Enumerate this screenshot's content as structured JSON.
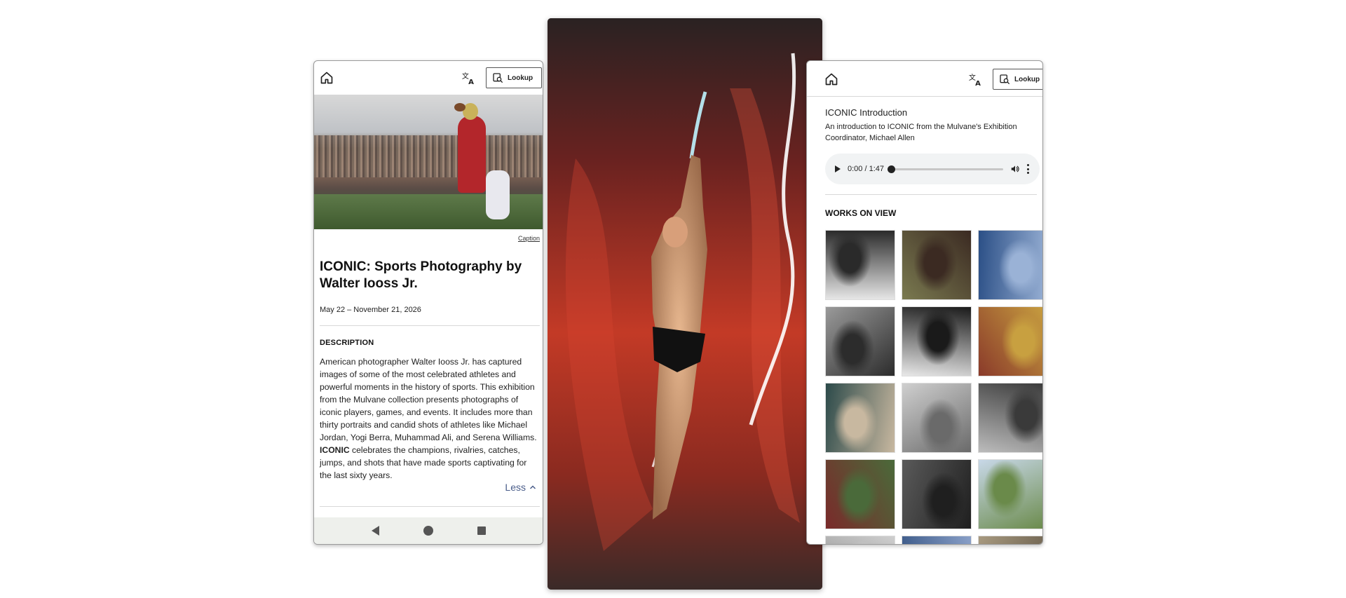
{
  "left_screen": {
    "lookup_label": "Lookup",
    "caption_link": "Caption",
    "title": "ICONIC: Sports Photography by Walter Iooss Jr.",
    "dates": "May 22 – November 21, 2026",
    "description_label": "DESCRIPTION",
    "description_part1": "American photographer Walter Iooss Jr. has captured images of some of the most celebrated athletes and powerful moments in the history of sports. This exhibition from the Mulvane collection presents photographs of iconic players, games, and events. It includes more than thirty portraits and candid shots of athletes like Michael Jordan, Yogi Berra, Muhammad Ali, and Serena Williams. ",
    "description_bold": "ICONIC",
    "description_part2": " celebrates the champions, rivalries, catches, jumps, and shots that have made sports captivating for the last sixty years.",
    "less_label": "Less"
  },
  "right_screen": {
    "lookup_label": "Lookup",
    "audio_title": "ICONIC Introduction",
    "audio_subtitle": "An introduction to ICONIC from the Mulvane's Exhibition Coordinator, Michael Allen",
    "audio_time": "0:00 / 1:47",
    "audio_progress": 0.0,
    "works_label": "WORKS ON VIEW",
    "thumbnails": [
      {
        "colors": [
          "#e6e6e6",
          "#2a2a2a"
        ]
      },
      {
        "colors": [
          "#7a7a50",
          "#3b2a22"
        ]
      },
      {
        "colors": [
          "#2b4f86",
          "#9ab2d6"
        ]
      },
      {
        "colors": [
          "#9a9a9a",
          "#2c2c2c"
        ]
      },
      {
        "colors": [
          "#e8e8e8",
          "#1a1a1a"
        ]
      },
      {
        "colors": [
          "#8a3a2a",
          "#c8a040"
        ]
      },
      {
        "colors": [
          "#2c4a4a",
          "#c8b8a0"
        ]
      },
      {
        "colors": [
          "#cfcfcf",
          "#6a6a6a"
        ]
      },
      {
        "colors": [
          "#bcbcbc",
          "#3a3a3a"
        ]
      },
      {
        "colors": [
          "#7a2a2a",
          "#4a6a3a"
        ]
      },
      {
        "colors": [
          "#5a5a5a",
          "#1f1f1f"
        ]
      },
      {
        "colors": [
          "#c8d8e8",
          "#6a8a4a"
        ]
      },
      {
        "colors": [
          "#7a7a7a",
          "#cfcfcf"
        ]
      },
      {
        "colors": [
          "#2a4a7a",
          "#8aa0c8"
        ]
      },
      {
        "colors": [
          "#a89a80",
          "#5a5040"
        ]
      }
    ]
  },
  "colors": {
    "accent_link": "#4a5d8a",
    "nav_bar": "#eef0ec"
  }
}
